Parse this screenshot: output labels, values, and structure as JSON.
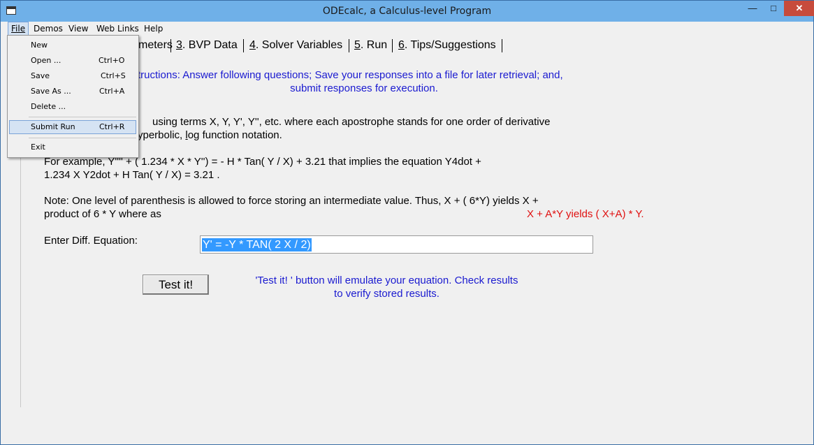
{
  "window": {
    "title": "ODEcalc, a Calculus-level Program"
  },
  "titlebar_buttons": {
    "minimize": "—",
    "maximize": "□",
    "close": "✕"
  },
  "menubar": [
    "File",
    "Demos",
    "View",
    "Web Links",
    "Help"
  ],
  "file_menu": [
    {
      "label": "New",
      "shortcut": ""
    },
    {
      "label": "Open ...",
      "shortcut": "Ctrl+O"
    },
    {
      "label": "Save",
      "shortcut": "Ctrl+S"
    },
    {
      "label": "Save As ...",
      "shortcut": "Ctrl+A"
    },
    {
      "label": "Delete ...",
      "shortcut": ""
    },
    {
      "label": "Submit Run",
      "shortcut": "Ctrl+R"
    },
    {
      "label": "Exit",
      "shortcut": ""
    }
  ],
  "tabs": [
    {
      "label": "meters"
    },
    {
      "num": "3",
      "label": ". BVP Data"
    },
    {
      "num": "4",
      "label": ". Solver Variables"
    },
    {
      "num": "5",
      "label": ". Run"
    },
    {
      "num": "6",
      "label": ". Tips/Suggestions"
    }
  ],
  "content": {
    "instructions_line1": "tructions: Answer following questions; Save your responses into a file for later retrieval; and,",
    "instructions_line2": "submit responses for execution.",
    "terms_line1": "using terms X, Y, Y', Y'', etc. where each apostrophe stands for one order of derivative",
    "terms_line2_a": "yperbolic, ",
    "terms_line2_u": "l",
    "terms_line2_b": "og function notation.",
    "example_line1": "For example, Y''''  +  ( 1.234 * X  *  Y'')  =  - H * Tan( Y / X) + 3.21 that implies the equation   Y4dot +",
    "example_line2": "1.234 X Y2dot   +   H Tan( Y / X)   = 3.21 .",
    "note_line1": "Note: One level of parenthesis is allowed to force storing an intermediate value. Thus, X + ( 6*Y) yields X +",
    "note_line2": "product of 6 * Y where as",
    "note_red": "X + A*Y yields ( X+A) * Y.",
    "equation_label": "Enter Diff. Equation:",
    "equation_value": "Y' = -Y * TAN( 2 X / 2)",
    "test_button": "Test it!",
    "test_note_line1": "'Test it! ' button will emulate your equation.  Check results",
    "test_note_line2": "to verify stored results."
  },
  "colors": {
    "titlebar": "#6fb0e8",
    "close": "#c74b3c",
    "blue_text": "#1a1ad0",
    "red_text": "#e01010",
    "selection": "#3399ff"
  }
}
